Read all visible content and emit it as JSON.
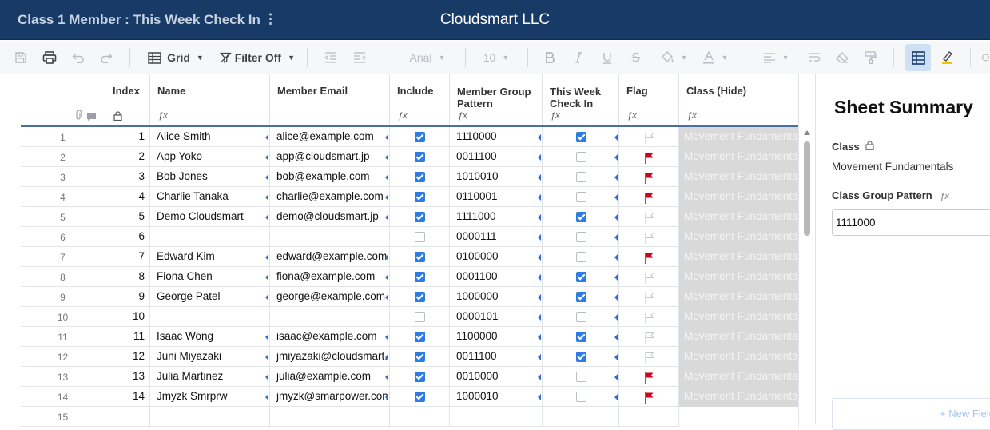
{
  "header": {
    "sheet_title": "Class 1 Member : This Week Check In",
    "more_glyph": "⋮",
    "company": "Cloudsmart LLC"
  },
  "toolbar": {
    "view_label": "Grid",
    "filter_label": "Filter Off",
    "font_name": "Arial",
    "font_size": "10"
  },
  "columns": {
    "index": "Index",
    "name": "Name",
    "email": "Member Email",
    "include": "Include",
    "pattern_line1": "Member Group",
    "pattern_line2": "Pattern",
    "checkin_line1": "This Week",
    "checkin_line2": "Check In",
    "flag": "Flag",
    "class": "Class (Hide)"
  },
  "rows": [
    {
      "row": "1",
      "index": "1",
      "name": "Alice Smith",
      "email": "alice@example.com",
      "include": true,
      "pattern": "1110000",
      "checkin": true,
      "flag": false,
      "class": "Movement Fundamentals"
    },
    {
      "row": "2",
      "index": "2",
      "name": "App Yoko",
      "email": "app@cloudsmart.jp",
      "include": true,
      "pattern": "0011100",
      "checkin": false,
      "flag": true,
      "class": "Movement Fundamentals"
    },
    {
      "row": "3",
      "index": "3",
      "name": "Bob Jones",
      "email": "bob@example.com",
      "include": true,
      "pattern": "1010010",
      "checkin": false,
      "flag": true,
      "class": "Movement Fundamentals"
    },
    {
      "row": "4",
      "index": "4",
      "name": "Charlie Tanaka",
      "email": "charlie@example.com",
      "include": true,
      "pattern": "0110001",
      "checkin": false,
      "flag": true,
      "class": "Movement Fundamentals"
    },
    {
      "row": "5",
      "index": "5",
      "name": "Demo Cloudsmart",
      "email": "demo@cloudsmart.jp",
      "include": true,
      "pattern": "1111000",
      "checkin": true,
      "flag": false,
      "class": "Movement Fundamentals"
    },
    {
      "row": "6",
      "index": "6",
      "name": "",
      "email": "",
      "include": false,
      "pattern": "0000111",
      "checkin": false,
      "flag": false,
      "class": "Movement Fundamentals"
    },
    {
      "row": "7",
      "index": "7",
      "name": "Edward Kim",
      "email": "edward@example.com",
      "include": true,
      "pattern": "0100000",
      "checkin": false,
      "flag": true,
      "class": "Movement Fundamentals"
    },
    {
      "row": "8",
      "index": "8",
      "name": "Fiona Chen",
      "email": "fiona@example.com",
      "include": true,
      "pattern": "0001100",
      "checkin": true,
      "flag": false,
      "class": "Movement Fundamentals"
    },
    {
      "row": "9",
      "index": "9",
      "name": "George Patel",
      "email": "george@example.com",
      "include": true,
      "pattern": "1000000",
      "checkin": true,
      "flag": false,
      "class": "Movement Fundamentals"
    },
    {
      "row": "10",
      "index": "10",
      "name": "",
      "email": "",
      "include": false,
      "pattern": "0000101",
      "checkin": false,
      "flag": false,
      "class": "Movement Fundamentals"
    },
    {
      "row": "11",
      "index": "11",
      "name": "Isaac Wong",
      "email": "isaac@example.com",
      "include": true,
      "pattern": "1100000",
      "checkin": true,
      "flag": false,
      "class": "Movement Fundamentals"
    },
    {
      "row": "12",
      "index": "12",
      "name": "Juni Miyazaki",
      "email": "jmiyazaki@cloudsmart.",
      "include": true,
      "pattern": "0011100",
      "checkin": true,
      "flag": false,
      "class": "Movement Fundamentals"
    },
    {
      "row": "13",
      "index": "13",
      "name": "Julia Martinez",
      "email": "julia@example.com",
      "include": true,
      "pattern": "0010000",
      "checkin": false,
      "flag": true,
      "class": "Movement Fundamentals"
    },
    {
      "row": "14",
      "index": "14",
      "name": "Jmyzk Smrprw",
      "email": "jmyzk@smarpower.con",
      "include": true,
      "pattern": "1000010",
      "checkin": false,
      "flag": true,
      "class": "Movement Fundamentals"
    },
    {
      "row": "15",
      "index": "",
      "name": "",
      "email": "",
      "include": null,
      "pattern": "",
      "checkin": null,
      "flag": null,
      "class": ""
    }
  ],
  "panel": {
    "title": "Sheet Summary",
    "class_label": "Class",
    "class_value": "Movement Fundamentals",
    "pattern_label": "Class Group Pattern",
    "pattern_value": "1111000",
    "new_field": "+ New Field"
  },
  "colors": {
    "header_bg": "#173a66",
    "checkbox": "#2f7be6",
    "flag": "#d0021b",
    "hidden_col": "#d9d9d9"
  }
}
